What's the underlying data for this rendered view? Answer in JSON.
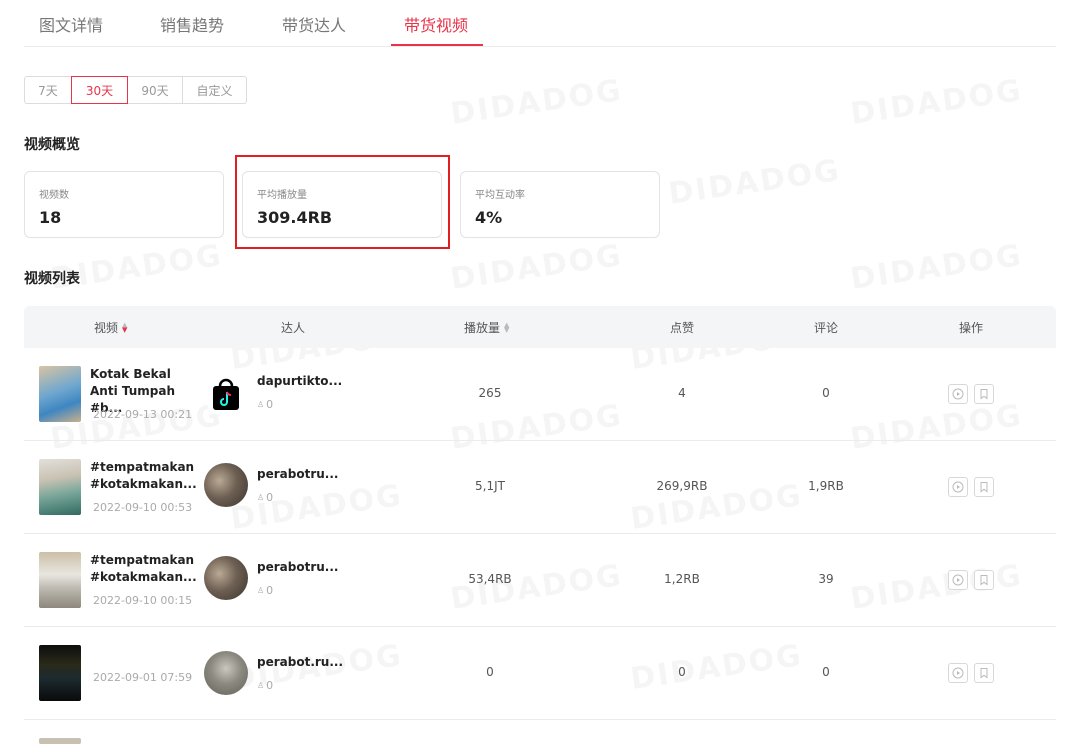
{
  "tabs": [
    "图文详情",
    "销售趋势",
    "带货达人",
    "带货视频"
  ],
  "ranges": [
    "7天",
    "30天",
    "90天",
    "自定义"
  ],
  "overview": {
    "title": "视频概览",
    "cards": [
      {
        "label": "视频数",
        "value": "18"
      },
      {
        "label": "平均播放量",
        "value": "309.4RB"
      },
      {
        "label": "平均互动率",
        "value": "4%"
      }
    ]
  },
  "list": {
    "title": "视频列表",
    "columns": [
      "视频",
      "达人",
      "播放量",
      "点赞",
      "评论",
      "操作"
    ],
    "rows": [
      {
        "title": "Kotak Bekal Anti Tumpah #b...",
        "date": "2022-09-13 00:21",
        "creator": "dapurtikto...",
        "fans": "0",
        "plays": "265",
        "likes": "4",
        "comments": "0"
      },
      {
        "title": "#tempatmakan #kotakmakan...",
        "date": "2022-09-10 00:53",
        "creator": "perabotru...",
        "fans": "0",
        "plays": "5,1JT",
        "likes": "269,9RB",
        "comments": "1,9RB"
      },
      {
        "title": "#tempatmakan #kotakmakan...",
        "date": "2022-09-10 00:15",
        "creator": "perabotru...",
        "fans": "0",
        "plays": "53,4RB",
        "likes": "1,2RB",
        "comments": "39"
      },
      {
        "title": "",
        "date": "2022-09-01 07:59",
        "creator": "perabot.ru...",
        "fans": "0",
        "plays": "0",
        "likes": "0",
        "comments": "0"
      }
    ]
  },
  "watermark": "DIDADOG",
  "colors": {
    "accent": "#e8344a",
    "highlight": "#e02020"
  }
}
